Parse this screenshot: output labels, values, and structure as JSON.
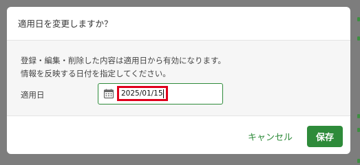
{
  "dialog": {
    "title": "適用日を変更しますか？",
    "message_line1": "登録・編集・削除した内容は適用日から有効になります。",
    "message_line2": "情報を反映する日付を指定してください。",
    "field_label": "適用日",
    "date_value": "2025/01/15",
    "cancel_label": "キャンセル",
    "save_label": "保存"
  },
  "colors": {
    "accent": "#2e8b3a",
    "highlight": "#e0001b",
    "overlay": "#7d7d7d"
  },
  "icons": {
    "date_field": "calendar-icon"
  }
}
